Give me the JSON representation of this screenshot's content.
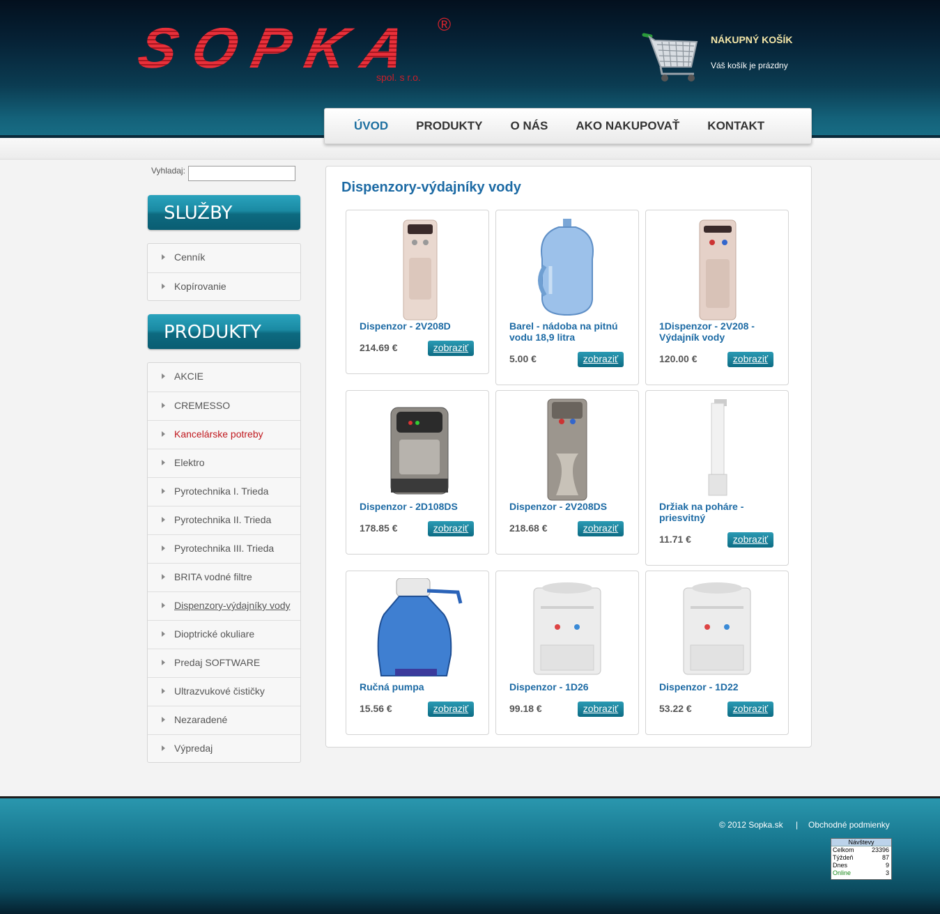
{
  "logo": {
    "text": "SOPKA",
    "registered": "®",
    "subtitle": "spol. s r.o."
  },
  "cart": {
    "title": "NÁKUPNÝ KOŠÍK",
    "status": "Váš košík je prázdny"
  },
  "nav": [
    "ÚVOD",
    "PRODUKTY",
    "O NÁS",
    "AKO NAKUPOVAŤ",
    "KONTAKT"
  ],
  "search": {
    "label": "Vyhladaj:",
    "value": ""
  },
  "sidebar": {
    "services_title": "SLUŽBY",
    "services": [
      "Cenník",
      "Kopírovanie"
    ],
    "products_title": "PRODUKTY",
    "products": [
      "AKCIE",
      "CREMESSO",
      "Kancelárske potreby",
      "Elektro",
      "Pyrotechnika I. Trieda",
      "Pyrotechnika II. Trieda",
      "Pyrotechnika III. Trieda",
      "BRITA vodné filtre",
      "Dispenzory-výdajníky vody",
      "Dioptrické okuliare",
      "Predaj SOFTWARE",
      "Ultrazvukové čističky",
      "Nezaradené",
      "Výpredaj"
    ]
  },
  "content": {
    "heading": "Dispenzory-výdajníky vody",
    "button_label": "zobraziť",
    "products": [
      {
        "name": "Dispenzor - 2V208D",
        "price": "214.69 €"
      },
      {
        "name": "Barel - nádoba na pitnú vodu 18,9 litra",
        "price": "5.00 €"
      },
      {
        "name": "1Dispenzor - 2V208 - Výdajník vody",
        "price": "120.00 €"
      },
      {
        "name": "Dispenzor - 2D108DS",
        "price": "178.85 €"
      },
      {
        "name": "Dispenzor - 2V208DS",
        "price": "218.68 €"
      },
      {
        "name": "Držiak na poháre - priesvitný",
        "price": "11.71 €"
      },
      {
        "name": "Ručná pumpa",
        "price": "15.56 €"
      },
      {
        "name": "Dispenzor - 1D26",
        "price": "99.18 €"
      },
      {
        "name": "Dispenzor - 1D22",
        "price": "53.22 €"
      }
    ]
  },
  "footer": {
    "copyright": "© 2012 Sopka.sk",
    "separator": "|",
    "terms": "Obchodné podmienky",
    "counter": {
      "title": "Návštevy",
      "rows": [
        {
          "label": "Celkom",
          "value": "23396"
        },
        {
          "label": "Týždeň",
          "value": "87"
        },
        {
          "label": "Dnes",
          "value": "9"
        },
        {
          "label": "Online",
          "value": "3"
        }
      ]
    }
  }
}
